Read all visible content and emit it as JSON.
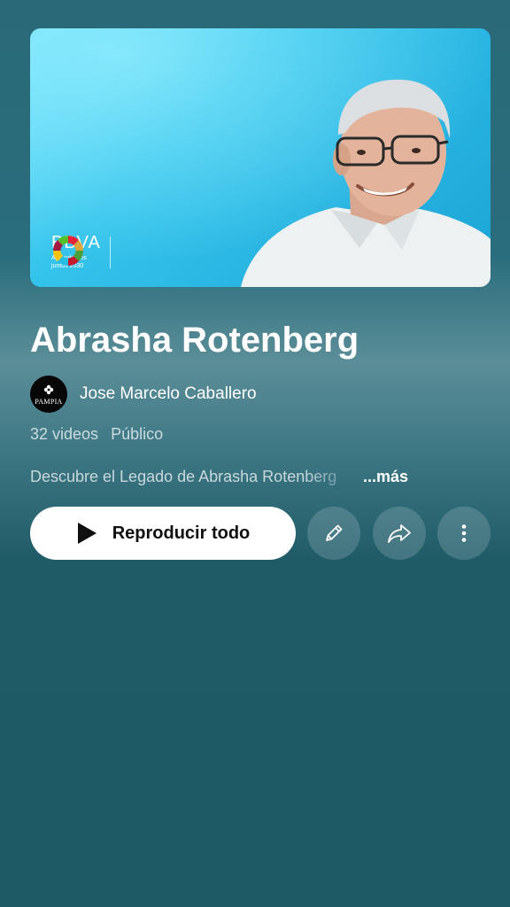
{
  "thumbnail": {
    "brand_name": "BBVA",
    "brand_tagline": "Aprendemos juntos 2030",
    "background_color": "#35c4ec"
  },
  "playlist": {
    "title": "Abrasha Rotenberg",
    "channel": {
      "name": "Jose Marcelo Caballero",
      "avatar_label": "PAMPIA"
    },
    "video_count": "32 videos",
    "visibility": "Público",
    "description": "Descubre el Legado de Abrasha Rotenberg",
    "more_label": "...más"
  },
  "actions": {
    "play_all_label": "Reproducir todo",
    "edit_icon": "pencil-icon",
    "share_icon": "share-arrow-icon",
    "more_icon": "vertical-dots-icon"
  },
  "colors": {
    "background": "#1e5966",
    "accent_button": "#ffffff",
    "text_primary": "#ffffff"
  }
}
